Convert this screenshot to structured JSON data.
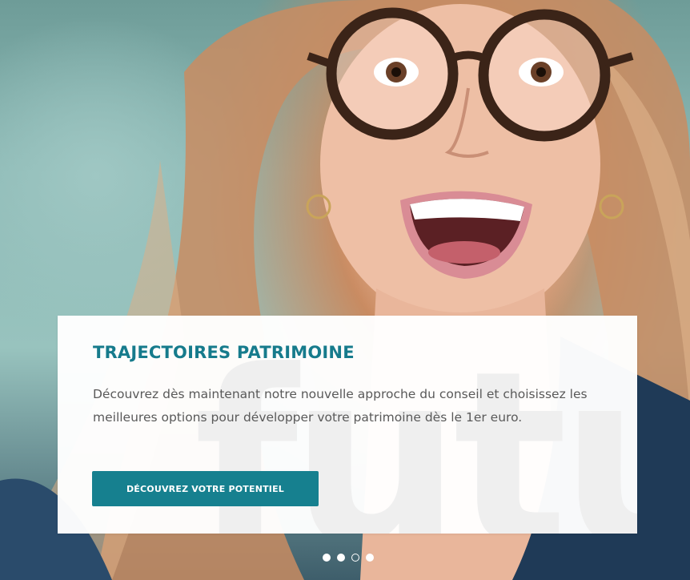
{
  "hero": {
    "image": "smiling-woman-with-glasses-photo",
    "watermark": "futu"
  },
  "card": {
    "title": "TRAJECTOIRES PATRIMOINE",
    "description": "Découvrez dès maintenant notre nouvelle approche du conseil et choisissez les meilleures options pour développer votre patrimoine dès le 1er euro.",
    "cta_label": "DÉCOUVREZ VOTRE POTENTIEL"
  },
  "carousel": {
    "slides": 4,
    "active_index": 2
  },
  "colors": {
    "accent": "#167b8c",
    "button": "#16808f",
    "body_text": "#595959"
  }
}
